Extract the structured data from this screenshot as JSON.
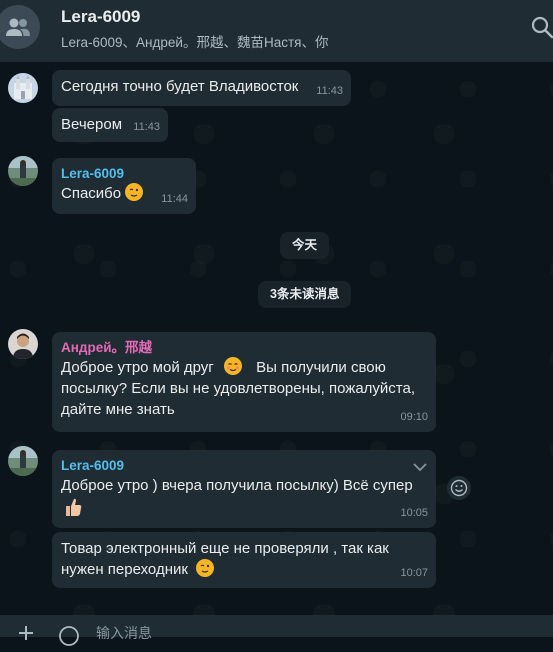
{
  "header": {
    "title": "Lera-6009",
    "members": "Lera-6009、Андрей。邢越、魏苗Настя、你"
  },
  "messages": [
    {
      "text": "Сегодня точно будет Владивосток",
      "time": "11:43"
    },
    {
      "text": "Вечером",
      "time": "11:43"
    },
    {
      "sender": "Lera-6009",
      "text": "Спасибо",
      "time": "11:44"
    },
    {
      "sender": "Андрей。邢越",
      "text_a": "Доброе утро мой друг",
      "text_b": "Вы получили свою посылку? Если вы не удовлетворены, пожалуйста, дайте мне знать",
      "time": "09:10"
    },
    {
      "sender": "Lera-6009",
      "text": "Доброе утро ) вчера получила посылку)  Всё супер",
      "time": "10:05"
    },
    {
      "text": "Товар электронный еще не проверяли , так как нужен переходник",
      "time": "10:07"
    }
  ],
  "date_divider": "今天",
  "unread_divider": "3条未读消息",
  "composer": {
    "placeholder": "输入消息"
  },
  "colors": {
    "background": "#0b141a",
    "bubble": "#202c33",
    "sender_lera": "#53bdeb",
    "sender_andrey": "#e26ab6",
    "timestamp": "#8696a0"
  },
  "icons": [
    "group-avatar-icon",
    "search-icon",
    "chevron-down-icon",
    "emoji-react-icon",
    "plus-icon",
    "emoji-icon"
  ]
}
